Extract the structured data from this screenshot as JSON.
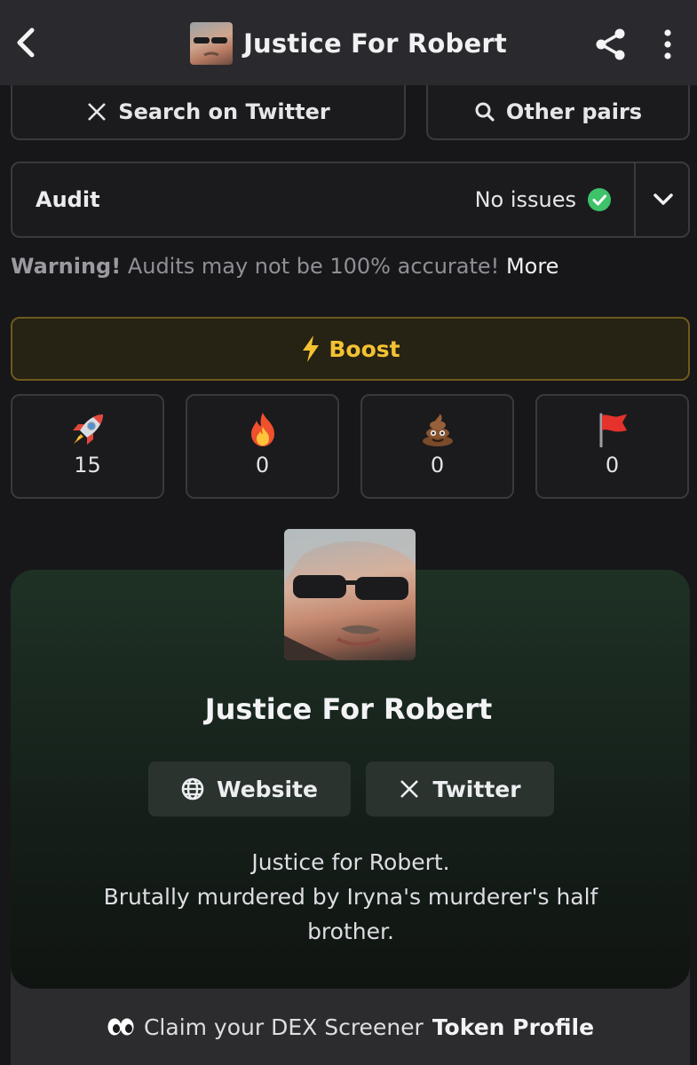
{
  "header": {
    "title": "Justice For Robert",
    "icons": {
      "back": "chevron-left-icon",
      "share": "share-icon",
      "more": "more-vertical-icon"
    }
  },
  "actions": {
    "search_twitter": "Search on Twitter",
    "other_pairs": "Other pairs"
  },
  "audit": {
    "label": "Audit",
    "status": "No issues",
    "status_color": "#3ec26a"
  },
  "warning": {
    "prefix": "Warning!",
    "text": "Audits may not be 100% accurate!",
    "more": "More"
  },
  "boost": {
    "label": "Boost",
    "color": "#f3c233"
  },
  "reactions": [
    {
      "icon": "rocket-icon",
      "count": "15"
    },
    {
      "icon": "fire-icon",
      "count": "0"
    },
    {
      "icon": "poop-icon",
      "count": "0"
    },
    {
      "icon": "red-flag-icon",
      "count": "0"
    }
  ],
  "profile": {
    "name": "Justice For Robert",
    "website_label": "Website",
    "twitter_label": "Twitter",
    "description_lines": [
      "Justice for Robert.",
      "Brutally murdered by Iryna's murderer's half",
      "brother."
    ]
  },
  "claim": {
    "prefix": "Claim your DEX Screener",
    "bold": "Token Profile"
  }
}
